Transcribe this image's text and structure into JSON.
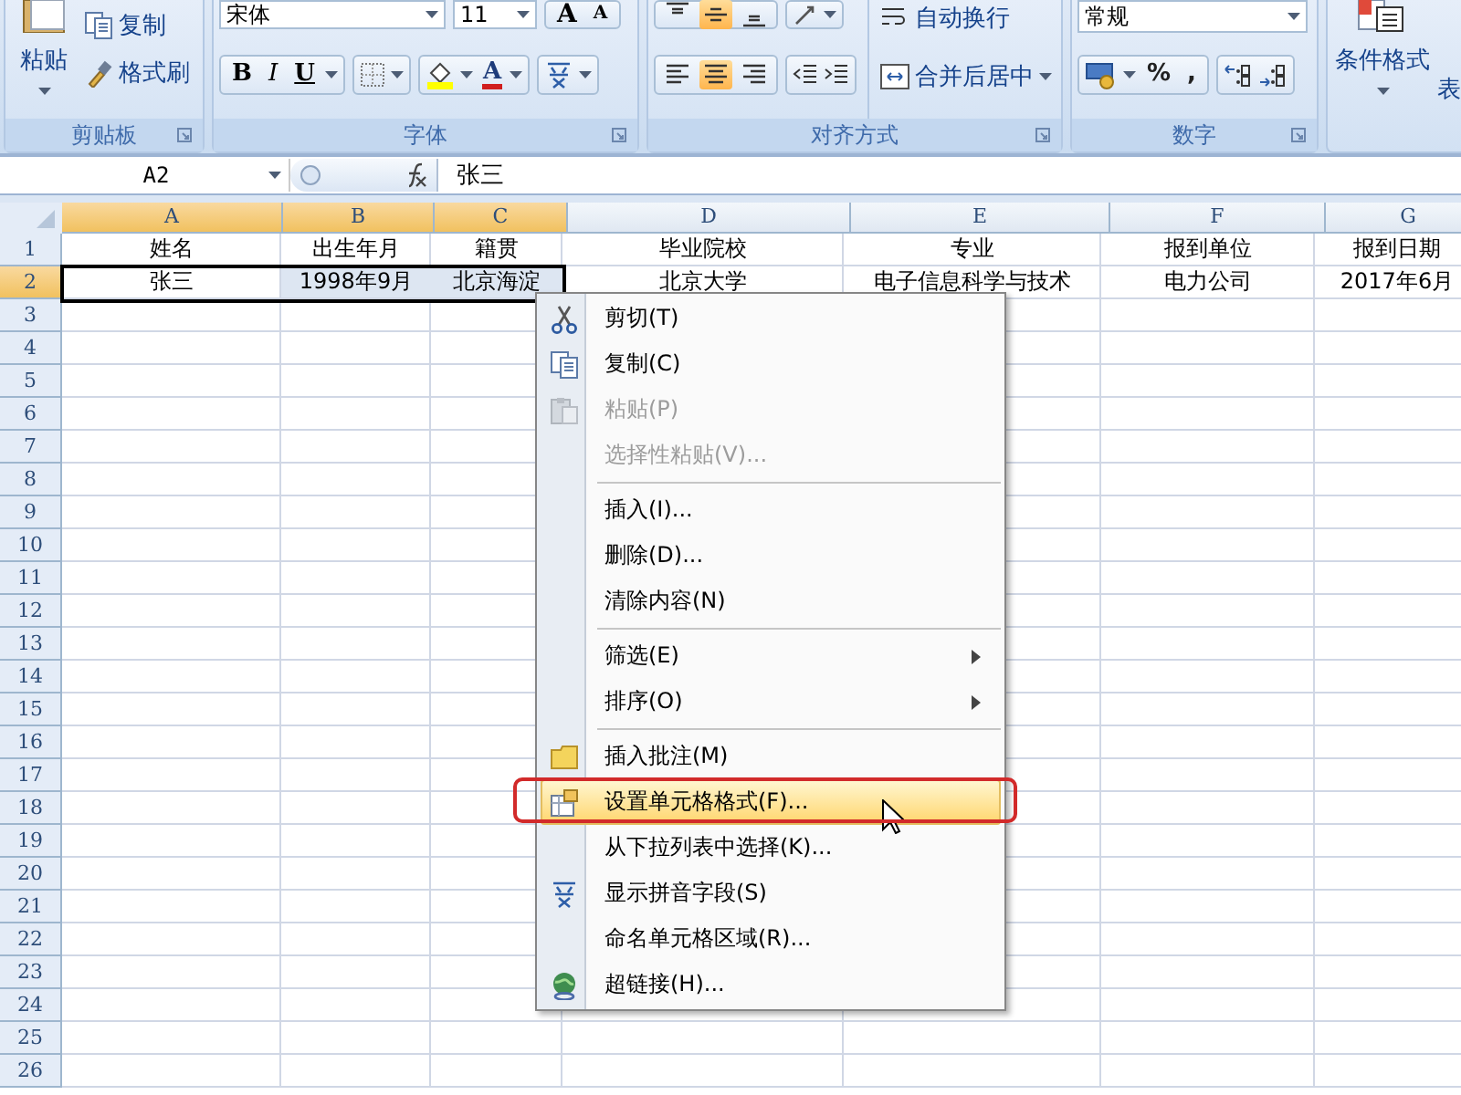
{
  "ribbon": {
    "clipboard": {
      "label": "剪贴板",
      "paste": "粘贴",
      "copy": "复制",
      "format_painter": "格式刷"
    },
    "font": {
      "label": "字体",
      "font_name": "宋体",
      "font_size": "11",
      "grow": "A",
      "shrink": "A",
      "styles": [
        "B",
        "I",
        "U"
      ],
      "font_color": "A"
    },
    "alignment": {
      "label": "对齐方式",
      "wrap_text": "自动换行",
      "merge_center": "合并后居中",
      "top_buttons": [
        {
          "kind": "top",
          "selected": false
        },
        {
          "kind": "middle",
          "selected": true
        },
        {
          "kind": "bottom",
          "selected": false
        }
      ],
      "bottom_buttons": [
        {
          "kind": "left",
          "selected": false
        },
        {
          "kind": "center",
          "selected": true
        },
        {
          "kind": "right",
          "selected": false
        }
      ]
    },
    "number": {
      "label": "数字",
      "format": "常规",
      "percent": "%",
      "comma": ","
    },
    "styles": {
      "conditional_format": "条件格式",
      "table_format": "表"
    }
  },
  "formula_bar": {
    "name_box": "A2",
    "content": "张三"
  },
  "sheet": {
    "columns": [
      {
        "label": "A",
        "selected": true
      },
      {
        "label": "B",
        "selected": true
      },
      {
        "label": "C",
        "selected": true
      },
      {
        "label": "D",
        "selected": false
      },
      {
        "label": "E",
        "selected": false
      },
      {
        "label": "F",
        "selected": false
      },
      {
        "label": "G",
        "selected": false
      }
    ],
    "rows": [
      {
        "label": "1",
        "selected": false,
        "cells": [
          {
            "text": "姓名",
            "selected": false,
            "active": false
          },
          {
            "text": "出生年月",
            "selected": false,
            "active": false
          },
          {
            "text": "籍贯",
            "selected": false,
            "active": false
          },
          {
            "text": "毕业院校",
            "selected": false,
            "active": false
          },
          {
            "text": "专业",
            "selected": false,
            "active": false
          },
          {
            "text": "报到单位",
            "selected": false,
            "active": false
          },
          {
            "text": "报到日期",
            "selected": false,
            "active": false
          }
        ]
      },
      {
        "label": "2",
        "selected": true,
        "cells": [
          {
            "text": "张三",
            "selected": false,
            "active": true
          },
          {
            "text": "1998年9月",
            "selected": true,
            "active": false
          },
          {
            "text": "北京海淀",
            "selected": true,
            "active": false
          },
          {
            "text": "北京大学",
            "selected": false,
            "active": false
          },
          {
            "text": "电子信息科学与技术",
            "selected": false,
            "active": false
          },
          {
            "text": "电力公司",
            "selected": false,
            "active": false
          },
          {
            "text": "2017年6月",
            "selected": false,
            "active": false
          }
        ]
      },
      {
        "label": "3",
        "selected": false
      },
      {
        "label": "4",
        "selected": false
      },
      {
        "label": "5",
        "selected": false
      },
      {
        "label": "6",
        "selected": false
      },
      {
        "label": "7",
        "selected": false
      },
      {
        "label": "8",
        "selected": false
      },
      {
        "label": "9",
        "selected": false
      },
      {
        "label": "10",
        "selected": false
      },
      {
        "label": "11",
        "selected": false
      },
      {
        "label": "12",
        "selected": false
      },
      {
        "label": "13",
        "selected": false
      },
      {
        "label": "14",
        "selected": false
      },
      {
        "label": "15",
        "selected": false
      },
      {
        "label": "16",
        "selected": false
      },
      {
        "label": "17",
        "selected": false
      },
      {
        "label": "18",
        "selected": false
      },
      {
        "label": "19",
        "selected": false
      },
      {
        "label": "20",
        "selected": false
      },
      {
        "label": "21",
        "selected": false
      },
      {
        "label": "22",
        "selected": false
      },
      {
        "label": "23",
        "selected": false
      },
      {
        "label": "24",
        "selected": false
      },
      {
        "label": "25",
        "selected": false
      },
      {
        "label": "26",
        "selected": false
      }
    ]
  },
  "context_menu": {
    "groups": [
      {
        "items": [
          {
            "label": "剪切(T)",
            "kind": "cut",
            "disabled": false,
            "submenu": false,
            "selected": false,
            "outlined": false
          },
          {
            "label": "复制(C)",
            "kind": "copy",
            "disabled": false,
            "submenu": false,
            "selected": false,
            "outlined": false
          },
          {
            "label": "粘贴(P)",
            "kind": "paste",
            "disabled": true,
            "submenu": false,
            "selected": false,
            "outlined": false
          },
          {
            "label": "选择性粘贴(V)...",
            "kind": "plain",
            "disabled": true,
            "submenu": false,
            "selected": false,
            "outlined": false
          }
        ]
      },
      {
        "items": [
          {
            "label": "插入(I)...",
            "kind": "plain",
            "disabled": false,
            "submenu": false,
            "selected": false,
            "outlined": false
          },
          {
            "label": "删除(D)...",
            "kind": "plain",
            "disabled": false,
            "submenu": false,
            "selected": false,
            "outlined": false
          },
          {
            "label": "清除内容(N)",
            "kind": "plain",
            "disabled": false,
            "submenu": false,
            "selected": false,
            "outlined": false
          }
        ]
      },
      {
        "items": [
          {
            "label": "筛选(E)",
            "kind": "plain",
            "disabled": false,
            "submenu": true,
            "selected": false,
            "outlined": false
          },
          {
            "label": "排序(O)",
            "kind": "plain",
            "disabled": false,
            "submenu": true,
            "selected": false,
            "outlined": false
          }
        ]
      },
      {
        "items": [
          {
            "label": "插入批注(M)",
            "kind": "comment",
            "disabled": false,
            "submenu": false,
            "selected": false,
            "outlined": false
          },
          {
            "label": "设置单元格格式(F)...",
            "kind": "format",
            "disabled": false,
            "submenu": false,
            "selected": true,
            "outlined": true
          },
          {
            "label": "从下拉列表中选择(K)...",
            "kind": "plain",
            "disabled": false,
            "submenu": false,
            "selected": false,
            "outlined": false
          },
          {
            "label": "显示拼音字段(S)",
            "kind": "phonetic",
            "disabled": false,
            "submenu": false,
            "selected": false,
            "outlined": false
          },
          {
            "label": "命名单元格区域(R)...",
            "kind": "plain",
            "disabled": false,
            "submenu": false,
            "selected": false,
            "outlined": false
          },
          {
            "label": "超链接(H)...",
            "kind": "link",
            "disabled": false,
            "submenu": false,
            "selected": false,
            "outlined": false
          }
        ]
      }
    ]
  }
}
